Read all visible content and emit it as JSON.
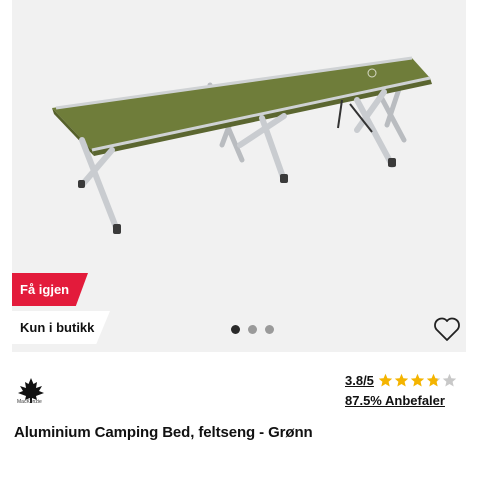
{
  "product": {
    "image_alt": "Green aluminium folding camping cot",
    "badges": {
      "again": "Få igjen",
      "store_only": "Kun i butikk"
    },
    "carousel": {
      "total": 3,
      "active": 1
    },
    "brand": "MacKenzie",
    "rating": {
      "text": "3.8/5",
      "value": 3.8,
      "max": 5
    },
    "recommend": "87.5% Anbefaler",
    "title": "Aluminium Camping Bed, feltseng - Grønn"
  },
  "colors": {
    "accent": "#e31b3b",
    "star": "#f4b400",
    "fabric": "#6f7d3a"
  },
  "icons": {
    "favorite": "heart-outline-icon",
    "brand_logo": "maple-leaf-logo",
    "rating": "star-icon"
  }
}
